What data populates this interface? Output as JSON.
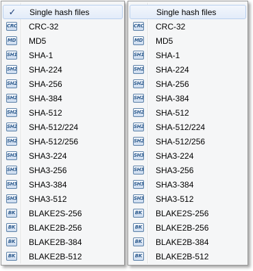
{
  "menus": [
    {
      "header_label": "Single hash files",
      "header_checked": true,
      "check_mark": "✓",
      "items": [
        {
          "icon_text": "CRC",
          "label": "CRC-32"
        },
        {
          "icon_text": "MD",
          "label": "MD5"
        },
        {
          "icon_text": "SH1",
          "label": "SHA-1"
        },
        {
          "icon_text": "SH2",
          "label": "SHA-224"
        },
        {
          "icon_text": "SH2",
          "label": "SHA-256"
        },
        {
          "icon_text": "SH2",
          "label": "SHA-384"
        },
        {
          "icon_text": "SH2",
          "label": "SHA-512"
        },
        {
          "icon_text": "SH2",
          "label": "SHA-512/224"
        },
        {
          "icon_text": "SH2",
          "label": "SHA-512/256"
        },
        {
          "icon_text": "SH3",
          "label": "SHA3-224"
        },
        {
          "icon_text": "SH3",
          "label": "SHA3-256"
        },
        {
          "icon_text": "SH3",
          "label": "SHA3-384"
        },
        {
          "icon_text": "SH3",
          "label": "SHA3-512"
        },
        {
          "icon_text": "BK",
          "label": "BLAKE2S-256"
        },
        {
          "icon_text": "BK",
          "label": "BLAKE2B-256"
        },
        {
          "icon_text": "BK",
          "label": "BLAKE2B-384"
        },
        {
          "icon_text": "BK",
          "label": "BLAKE2B-512"
        }
      ]
    },
    {
      "header_label": "Single hash files",
      "header_checked": false,
      "check_mark": "",
      "items": [
        {
          "icon_text": "CRC",
          "label": "CRC-32"
        },
        {
          "icon_text": "MD",
          "label": "MD5"
        },
        {
          "icon_text": "SH1",
          "label": "SHA-1"
        },
        {
          "icon_text": "SH2",
          "label": "SHA-224"
        },
        {
          "icon_text": "SH2",
          "label": "SHA-256"
        },
        {
          "icon_text": "SH2",
          "label": "SHA-384"
        },
        {
          "icon_text": "SH2",
          "label": "SHA-512"
        },
        {
          "icon_text": "SH2",
          "label": "SHA-512/224"
        },
        {
          "icon_text": "SH2",
          "label": "SHA-512/256"
        },
        {
          "icon_text": "SH3",
          "label": "SHA3-224"
        },
        {
          "icon_text": "SH3",
          "label": "SHA3-256"
        },
        {
          "icon_text": "SH3",
          "label": "SHA3-384"
        },
        {
          "icon_text": "SH3",
          "label": "SHA3-512"
        },
        {
          "icon_text": "BK",
          "label": "BLAKE2S-256"
        },
        {
          "icon_text": "BK",
          "label": "BLAKE2B-256"
        },
        {
          "icon_text": "BK",
          "label": "BLAKE2B-384"
        },
        {
          "icon_text": "BK",
          "label": "BLAKE2B-512"
        }
      ]
    }
  ]
}
